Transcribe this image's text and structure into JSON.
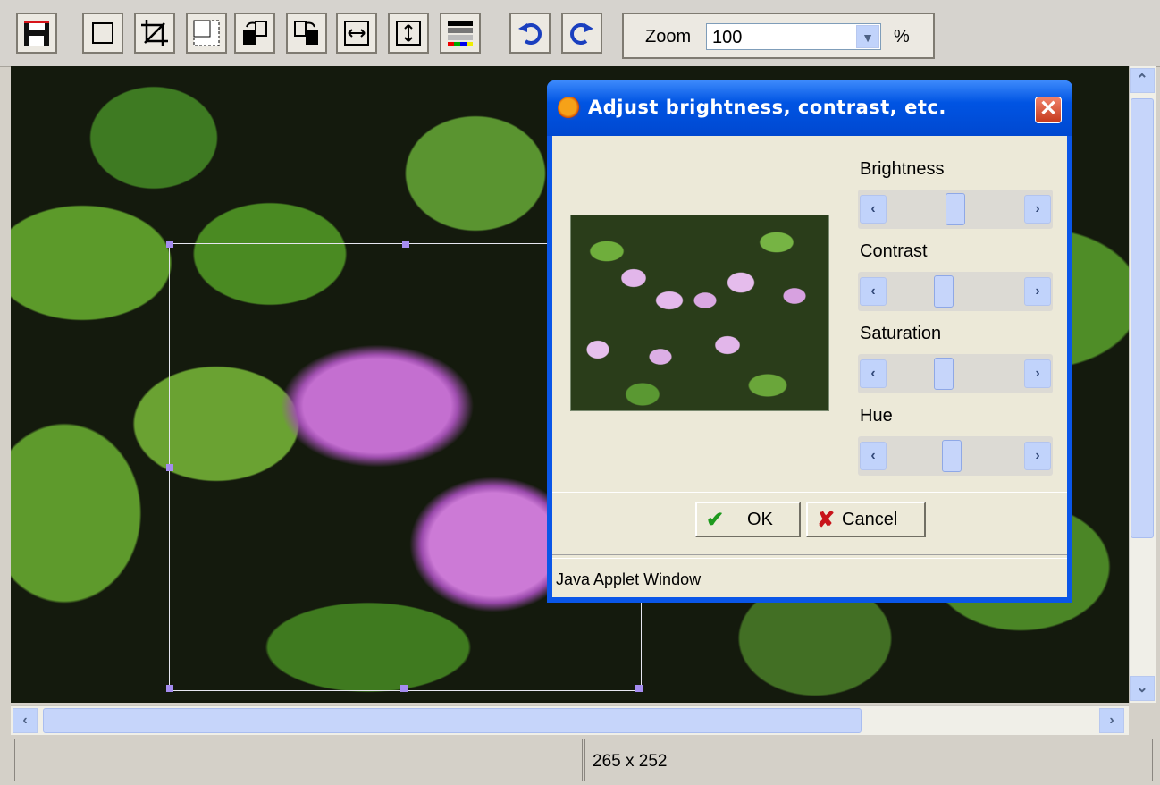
{
  "toolbar": {
    "buttons": [
      {
        "name": "save-icon"
      },
      {
        "name": "select-rectangle-icon"
      },
      {
        "name": "crop-icon"
      },
      {
        "name": "resize-icon"
      },
      {
        "name": "rotate-left-icon"
      },
      {
        "name": "rotate-right-icon"
      },
      {
        "name": "flip-horizontal-icon"
      },
      {
        "name": "flip-vertical-icon"
      },
      {
        "name": "color-adjust-icon"
      },
      {
        "name": "undo-icon"
      },
      {
        "name": "redo-icon"
      }
    ],
    "zoom": {
      "label": "Zoom",
      "value": "100",
      "unit": "%"
    }
  },
  "dialog": {
    "title": "Adjust brightness, contrast, etc.",
    "close_glyph": "✕",
    "sliders": [
      {
        "label": "Brightness",
        "value": 0.5
      },
      {
        "label": "Contrast",
        "value": 0.4
      },
      {
        "label": "Saturation",
        "value": 0.4
      },
      {
        "label": "Hue",
        "value": 0.47
      }
    ],
    "ok_label": "OK",
    "ok_glyph": "✔",
    "cancel_label": "Cancel",
    "cancel_glyph": "✘",
    "applet_text": "Java Applet Window"
  },
  "scroll": {
    "up": "⌃",
    "down": "⌄",
    "left": "‹",
    "right": "›"
  },
  "status": {
    "left": "",
    "right": "265 x 252"
  },
  "colors": {
    "accent": "#0054e3",
    "thumb": "#c6d5fa",
    "dialog_bg": "#ece9d8"
  }
}
